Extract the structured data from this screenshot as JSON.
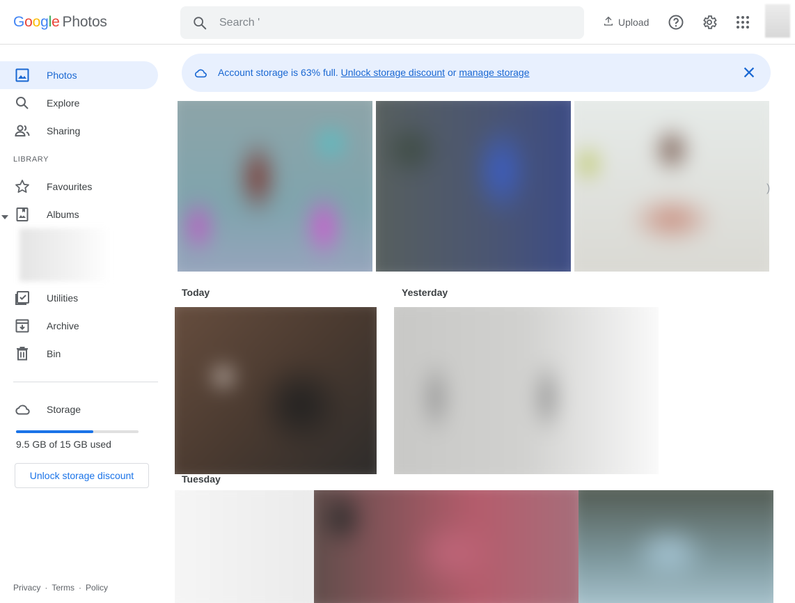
{
  "app": {
    "logo": [
      "G",
      "o",
      "o",
      "g",
      "l",
      "e"
    ],
    "product": "Photos"
  },
  "search": {
    "placeholder": "Search '"
  },
  "toolbar": {
    "upload_label": "Upload"
  },
  "sidebar": {
    "items": [
      {
        "label": "Photos"
      },
      {
        "label": "Explore"
      },
      {
        "label": "Sharing"
      }
    ],
    "library_label": "LIBRARY",
    "library_items": [
      {
        "label": "Favourites"
      },
      {
        "label": "Albums"
      },
      {
        "label": "Utilities"
      },
      {
        "label": "Archive"
      },
      {
        "label": "Bin"
      }
    ],
    "storage_label": "Storage",
    "storage_used_fraction": 0.63,
    "storage_text": "9.5 GB of 15 GB used",
    "unlock_button": "Unlock storage discount",
    "footer": {
      "privacy": "Privacy",
      "terms": "Terms",
      "policy": "Policy",
      "sep": "·"
    }
  },
  "banner": {
    "message": "Account storage is 63% full.",
    "link1": "Unlock storage discount",
    "joiner": "or",
    "link2": "manage storage"
  },
  "dates": {
    "today": "Today",
    "yesterday": "Yesterday",
    "tuesday": "Tuesday"
  },
  "colors": {
    "accent": "#1a73e8",
    "active_bg": "#e8f0fe",
    "banner_text": "#1967d2"
  }
}
